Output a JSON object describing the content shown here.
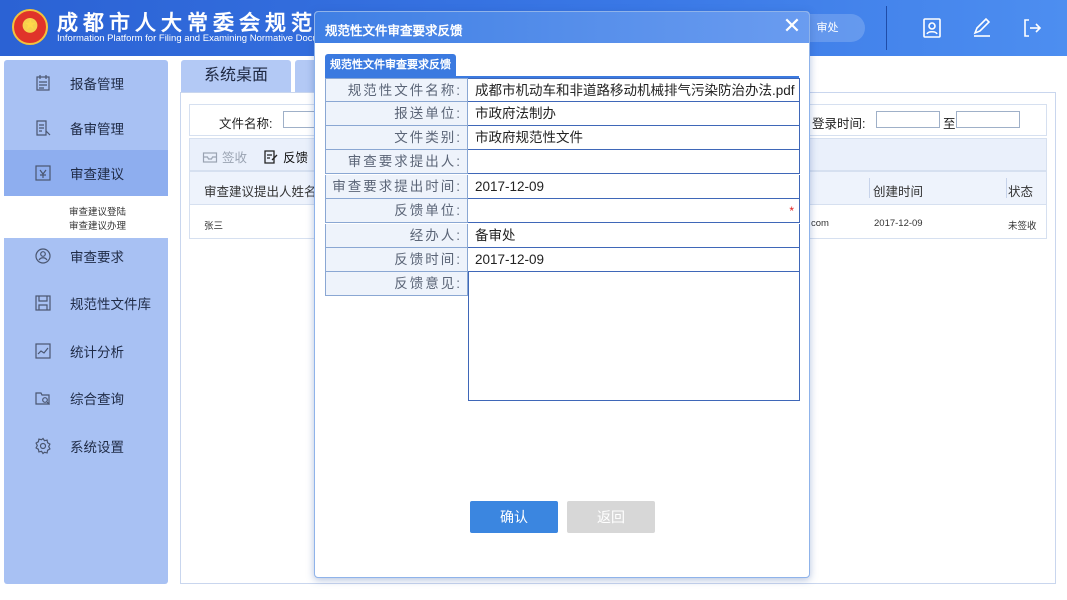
{
  "header": {
    "title": "成都市人大常委会规范性",
    "subtitle": "Information Platform for Filing and Examining Normative Documen",
    "dept_label": "审处",
    "icons": [
      "contact-card-icon",
      "edit-icon",
      "logout-icon"
    ]
  },
  "sidebar": {
    "items": [
      {
        "label": "报备管理",
        "icon": "calendar-icon"
      },
      {
        "label": "备审管理",
        "icon": "document-edit-icon"
      },
      {
        "label": "审查建议",
        "icon": "report-icon"
      },
      {
        "label": "审查要求",
        "icon": "user-circle-icon"
      },
      {
        "label": "规范性文件库",
        "icon": "save-icon"
      },
      {
        "label": "统计分析",
        "icon": "chart-icon"
      },
      {
        "label": "综合查询",
        "icon": "search-folder-icon"
      },
      {
        "label": "系统设置",
        "icon": "gear-icon"
      }
    ],
    "subitems": [
      "审查建议登陆",
      "审查建议办理"
    ]
  },
  "main": {
    "tab_home": "系统桌面",
    "filter": {
      "file_name_label": "文件名称:",
      "login_time_label": "登录时间:",
      "to_label": "至"
    },
    "toolbar": {
      "sign_label": "签收",
      "feedback_label": "反馈"
    },
    "table": {
      "headers": [
        "审查建议提出人姓名",
        "创建时间",
        "状态"
      ],
      "row": {
        "name": "张三",
        "email_tail": "com",
        "created": "2017-12-09",
        "status": "未签收"
      }
    }
  },
  "modal": {
    "title": "规范性文件审查要求反馈",
    "tab_label": "规范性文件审查要求反馈",
    "fields": [
      {
        "label": "规范性文件名称:",
        "value": "成都市机动车和非道路移动机械排气污染防治办法.pdf"
      },
      {
        "label": "报送单位:",
        "value": "市政府法制办"
      },
      {
        "label": "文件类别:",
        "value": "市政府规范性文件"
      },
      {
        "label": "审查要求提出人:",
        "value": ""
      },
      {
        "label": "审查要求提出时间:",
        "value": "2017-12-09"
      },
      {
        "label": "反馈单位:",
        "value": "",
        "required": "*"
      },
      {
        "label": "经办人:",
        "value": "备审处"
      },
      {
        "label": "反馈时间:",
        "value": "2017-12-09"
      },
      {
        "label": "反馈意见:",
        "value": ""
      }
    ],
    "ok_label": "确认",
    "back_label": "返回"
  },
  "colors": {
    "header_bg": "#3a78e6",
    "sidebar_bg": "#a8c1f3",
    "modal_head": "#3f7fe4",
    "primary_button": "#3b86e0",
    "disabled_button": "#d7d7d7",
    "required_star": "#e02020"
  }
}
